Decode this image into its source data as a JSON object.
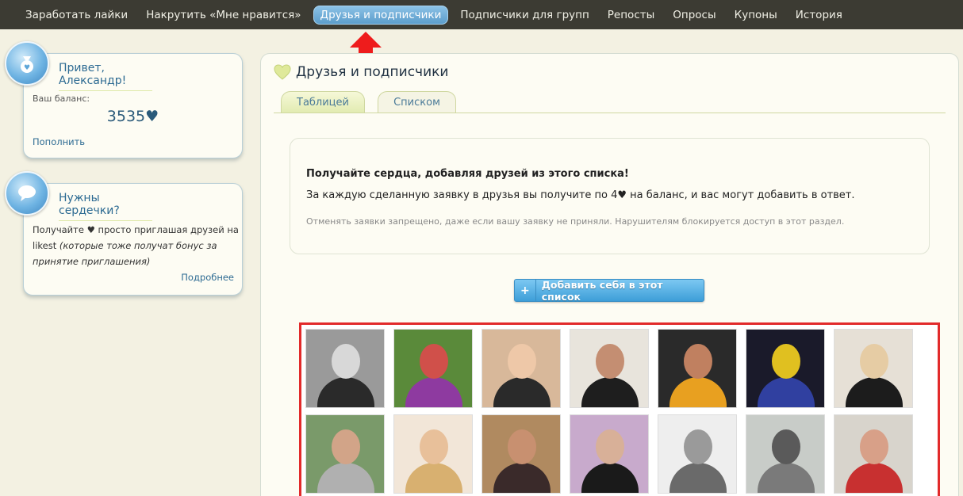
{
  "nav": {
    "items": [
      {
        "label": "Заработать лайки",
        "active": false
      },
      {
        "label": "Накрутить «Мне нравится»",
        "active": false
      },
      {
        "label": "Друзья и подписчики",
        "active": true
      },
      {
        "label": "Подписчики для групп",
        "active": false
      },
      {
        "label": "Репосты",
        "active": false
      },
      {
        "label": "Опросы",
        "active": false
      },
      {
        "label": "Купоны",
        "active": false
      },
      {
        "label": "История",
        "active": false
      }
    ]
  },
  "sidebar": {
    "greeting": {
      "title": "Привет, Александр!",
      "balance_label": "Ваш баланс:",
      "balance_value": "3535♥",
      "topup_link": "Пополнить",
      "icon": "money-bag-icon"
    },
    "hearts": {
      "title": "Нужны сердечки?",
      "text_main": "Получайте ♥ просто приглашая друзей на likest ",
      "text_italic": "(которые тоже получат бонус за принятие приглашения)",
      "more_link": "Подробнее",
      "icon": "speech-bubble-icon"
    }
  },
  "main": {
    "title": "Друзья и подписчики",
    "tabs": [
      {
        "label": "Таблицей",
        "active": true
      },
      {
        "label": "Списком",
        "active": false
      }
    ],
    "info": {
      "title": "Получайте сердца, добавляя друзей из этого списка!",
      "text": "За каждую сделанную заявку в друзья вы получите по 4♥ на баланс, и вас могут добавить в ответ.",
      "note": "Отменять заявки запрещено, даже если вашу заявку не приняли. Нарушителям блокируется доступ в этот раздел."
    },
    "add_button": {
      "plus": "+",
      "label": "Добавить себя в этот список"
    }
  },
  "colors": {
    "nav_bg": "#3c3b33",
    "accent": "#5c9dcb",
    "highlight_red": "#e22a2a",
    "page_bg": "#f3f1e2"
  },
  "photos": [
    {
      "bg": "#9a9a9a",
      "head": "#d8d8d8",
      "body": "#2a2a2a"
    },
    {
      "bg": "#5a8a3a",
      "head": "#d0504a",
      "body": "#8e3aa0"
    },
    {
      "bg": "#d8b89a",
      "head": "#eec8a8",
      "body": "#2a2a2a"
    },
    {
      "bg": "#e8e4dc",
      "head": "#c48e72",
      "body": "#1e1e1e"
    },
    {
      "bg": "#2a2a2a",
      "head": "#c08060",
      "body": "#e8a020"
    },
    {
      "bg": "#1a1a2a",
      "head": "#e0c020",
      "body": "#3040a0"
    },
    {
      "bg": "#e6e0d6",
      "head": "#e6cca4",
      "body": "#1c1c1c"
    },
    {
      "bg": "#7a9a6a",
      "head": "#d2a488",
      "body": "#b0b0b0"
    },
    {
      "bg": "#f2e6d8",
      "head": "#e8c09a",
      "body": "#d8b070"
    },
    {
      "bg": "#b08a60",
      "head": "#c89070",
      "body": "#3a2a2a"
    },
    {
      "bg": "#c8aacc",
      "head": "#d8b098",
      "body": "#1a1a1a"
    },
    {
      "bg": "#eeeeee",
      "head": "#9a9a9a",
      "body": "#6a6a6a"
    },
    {
      "bg": "#c8ccc8",
      "head": "#5a5a5a",
      "body": "#7a7a7a"
    },
    {
      "bg": "#d8d4cc",
      "head": "#d8a088",
      "body": "#c83030"
    }
  ]
}
